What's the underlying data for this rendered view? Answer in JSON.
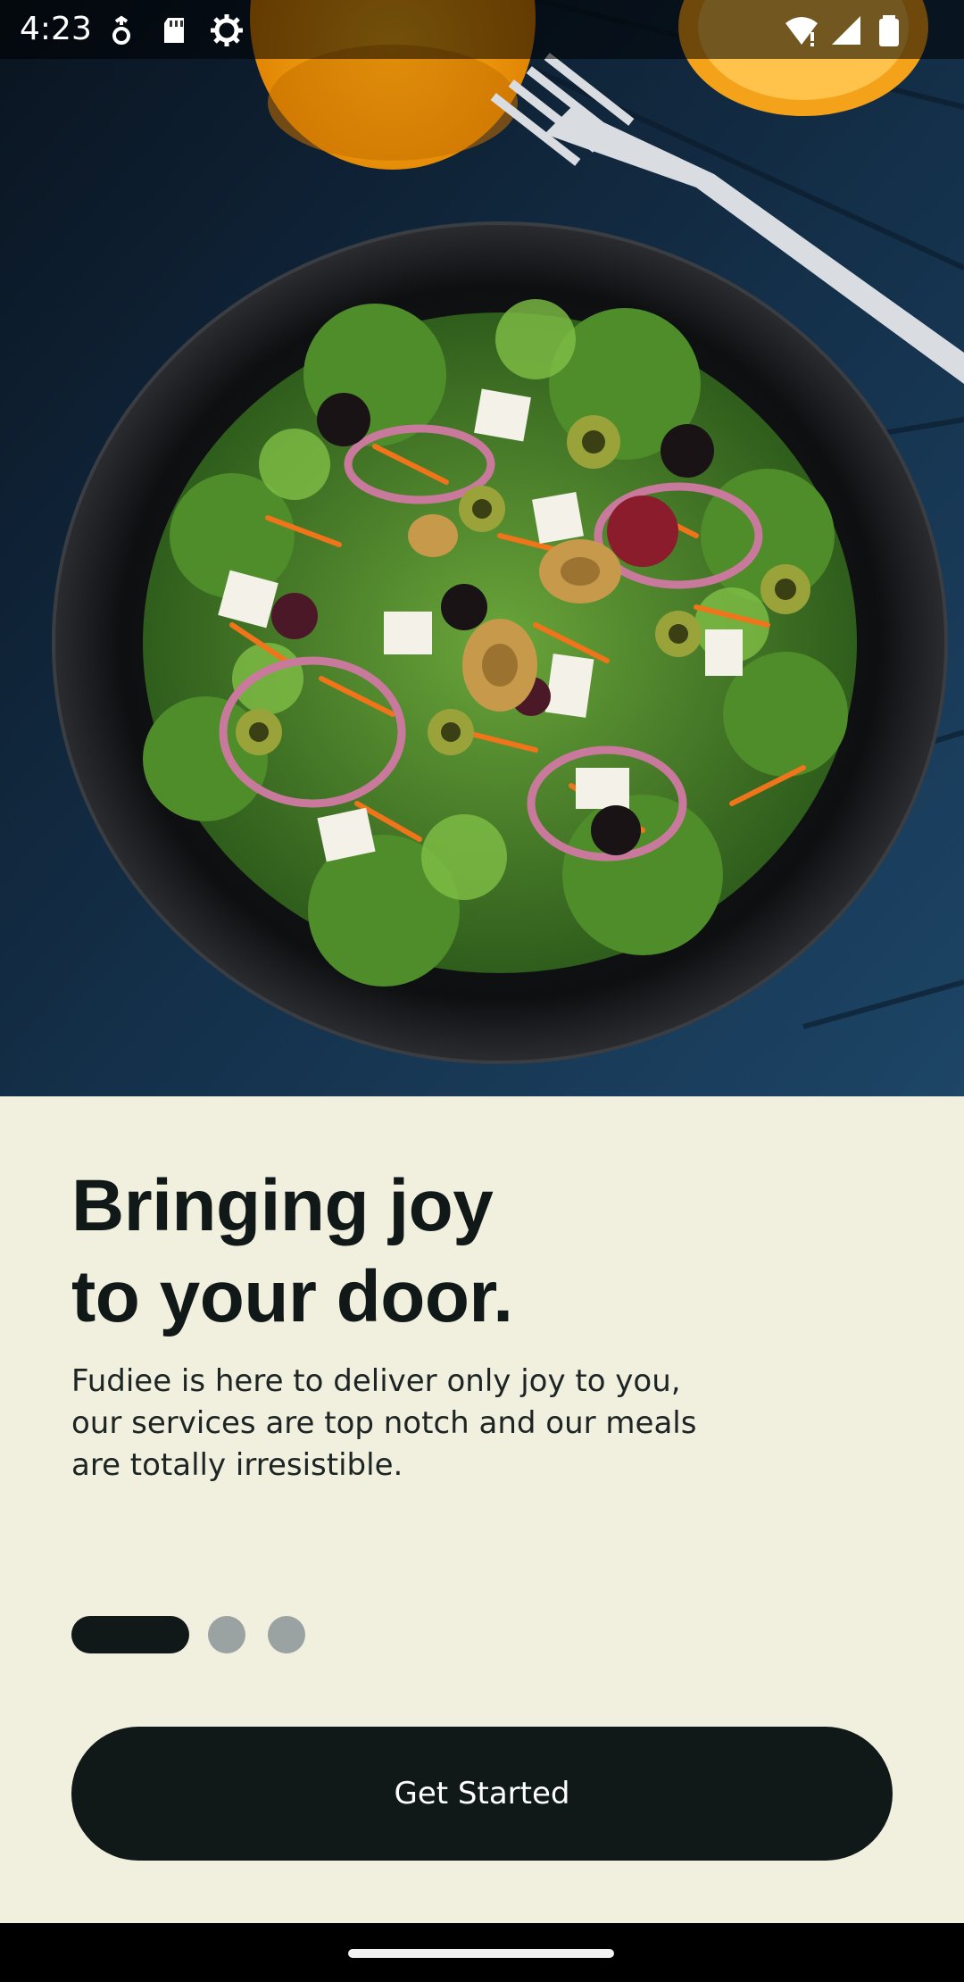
{
  "status_bar": {
    "time": "4:23",
    "left_icons": [
      "data-saver-icon",
      "sd-card-icon",
      "settings-gear-icon"
    ],
    "right_icons": [
      "wifi-icon",
      "signal-icon",
      "battery-icon"
    ]
  },
  "hero": {
    "image": "salad-plate-photo"
  },
  "onboarding": {
    "headline_line1": "Bringing joy",
    "headline_line2": "to your door.",
    "description_line1": "Fudiee is here to deliver only joy to you,",
    "description_line2": "our services are top notch and our meals",
    "description_line3": "are totally irresistible.",
    "page_indicator": {
      "current": 1,
      "total": 3
    },
    "cta_label": "Get Started"
  },
  "colors": {
    "background": "#f1f0df",
    "primary": "#101818",
    "indicator_inactive": "#9aa2a2"
  }
}
